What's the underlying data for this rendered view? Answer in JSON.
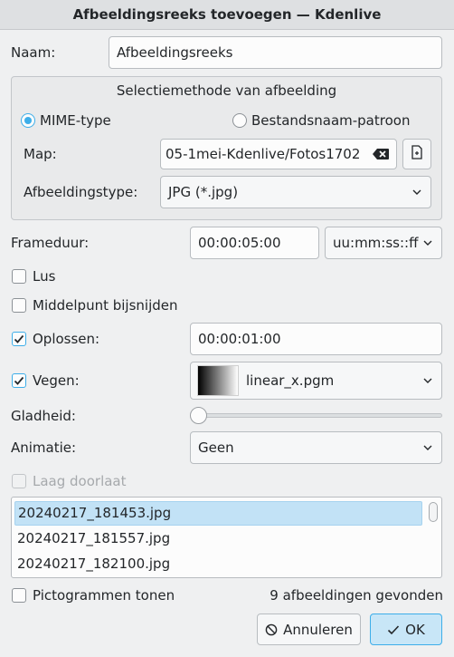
{
  "window": {
    "title": "Afbeeldingsreeks toevoegen — Kdenlive"
  },
  "name": {
    "label": "Naam:",
    "value": "Afbeeldingsreeks"
  },
  "selection": {
    "title": "Selectiemethode van afbeelding",
    "mime_label": "MIME-type",
    "pattern_label": "Bestandsnaam-patroon",
    "folder_label": "Map:",
    "folder_value": "05-1mei-Kdenlive/Fotos1702",
    "type_label": "Afbeeldingstype:",
    "type_value": "JPG (*.jpg)"
  },
  "frame_duration": {
    "label": "Frameduur:",
    "value": "00:00:05:00",
    "format": "uu:mm:ss::ff"
  },
  "loop": {
    "label": "Lus"
  },
  "center_crop": {
    "label": "Middelpunt bijsnijden"
  },
  "dissolve": {
    "label": "Oplossen:",
    "value": "00:00:01:00"
  },
  "wipe": {
    "label": "Vegen:",
    "value": "linear_x.pgm"
  },
  "softness": {
    "label": "Gladheid:",
    "level": 0
  },
  "animation": {
    "label": "Animatie:",
    "value": "Geen"
  },
  "alpha": {
    "label": "Laag doorlaat"
  },
  "files": [
    "20240217_181453.jpg",
    "20240217_181557.jpg",
    "20240217_182100.jpg"
  ],
  "footer": {
    "show_thumbs": "Pictogrammen tonen",
    "count": "9 afbeeldingen gevonden",
    "cancel": "Annuleren",
    "ok": "OK"
  },
  "colors": {
    "accent": "#3daee9",
    "selection": "#c2e2f6"
  },
  "icons": [
    "backspace-icon",
    "file-open-icon",
    "chevron-down-icon",
    "checkmark-icon",
    "cancel-icon"
  ]
}
